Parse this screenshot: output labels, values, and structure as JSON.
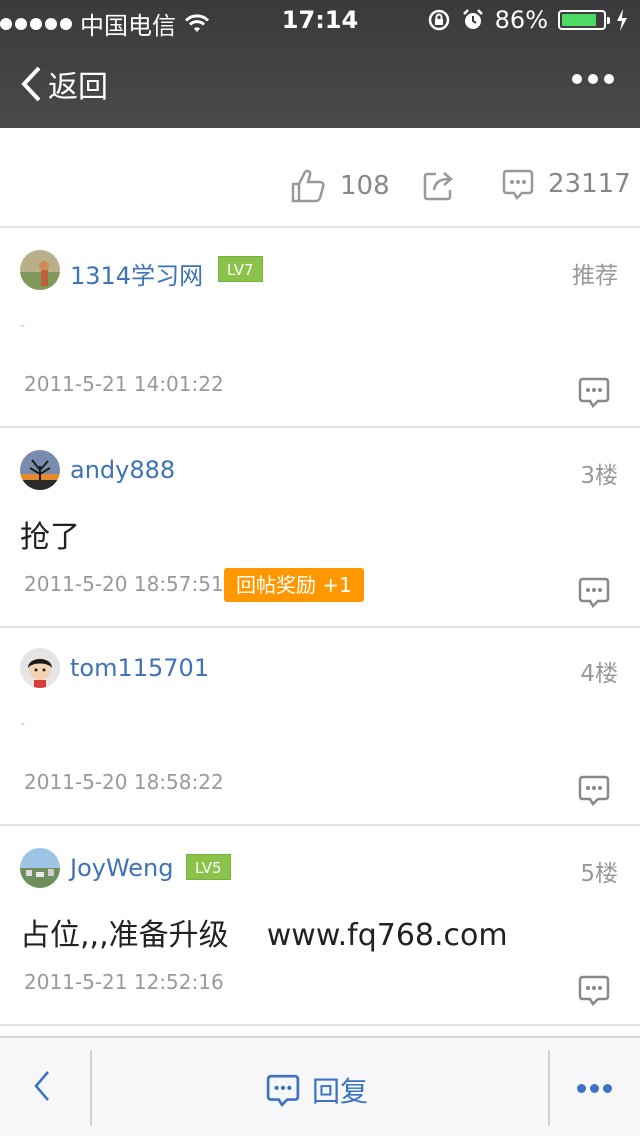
{
  "status_bar": {
    "carrier": "中国电信",
    "time": "17:14",
    "battery": "86%",
    "battery_level": 0.86
  },
  "nav": {
    "back_label": "返回"
  },
  "stats": {
    "likes": "108",
    "comments": "23117"
  },
  "posts": [
    {
      "username": "1314学习网",
      "level": "LV7",
      "floor": "推荐",
      "content": "-",
      "time": "2011-5-21 14:01:22"
    },
    {
      "username": "andy888",
      "level": "",
      "floor": "3楼",
      "content": "抢了",
      "time": "2011-5-20 18:57:51",
      "reward": "回帖奖励 +1"
    },
    {
      "username": "tom115701",
      "level": "",
      "floor": "4楼",
      "content": "-",
      "time": "2011-5-20 18:58:22"
    },
    {
      "username": "JoyWeng",
      "level": "LV5",
      "floor": "5楼",
      "content": "占位,,,准备升级    www.fq768.com",
      "time": "2011-5-21 12:52:16"
    }
  ],
  "bottom_bar": {
    "reply_label": "回复"
  },
  "colors": {
    "link_blue": "#3f72b8",
    "level_green": "#8bc34a",
    "reward_orange": "#ff9800",
    "header_dark": "#3a3a3c"
  }
}
